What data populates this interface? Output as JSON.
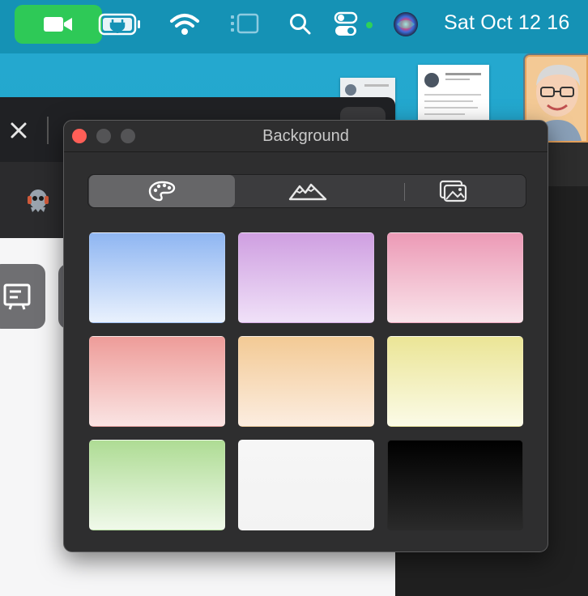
{
  "menubar": {
    "clock": "Sat Oct 12  16",
    "icons": [
      "facetime-video-icon",
      "battery-charging-icon",
      "wifi-icon",
      "stage-manager-icon",
      "search-icon",
      "control-center-icon",
      "siri-icon"
    ]
  },
  "panel": {
    "title": "Background",
    "tabs": [
      {
        "name": "colors",
        "icon": "palette-icon",
        "selected": true
      },
      {
        "name": "landscapes",
        "icon": "mountains-icon",
        "selected": false
      },
      {
        "name": "photos",
        "icon": "photos-icon",
        "selected": false
      }
    ],
    "swatches": [
      {
        "name": "blue",
        "top": "#8fb6f2",
        "bottom": "#e9f1fd"
      },
      {
        "name": "purple",
        "top": "#cf9fe1",
        "bottom": "#f0e1f8"
      },
      {
        "name": "pink",
        "top": "#ec9ab6",
        "bottom": "#f9e3ea"
      },
      {
        "name": "red",
        "top": "#ee9c99",
        "bottom": "#fae4e3"
      },
      {
        "name": "orange",
        "top": "#f3ca95",
        "bottom": "#fcede0"
      },
      {
        "name": "yellow",
        "top": "#ebe596",
        "bottom": "#fbfbe7"
      },
      {
        "name": "green",
        "top": "#aedc94",
        "bottom": "#f0f9ea"
      },
      {
        "name": "white",
        "top": "#f6f6f6",
        "bottom": "#f3f3f3"
      },
      {
        "name": "black",
        "top": "#000000",
        "bottom": "#2a2a2a"
      }
    ]
  }
}
